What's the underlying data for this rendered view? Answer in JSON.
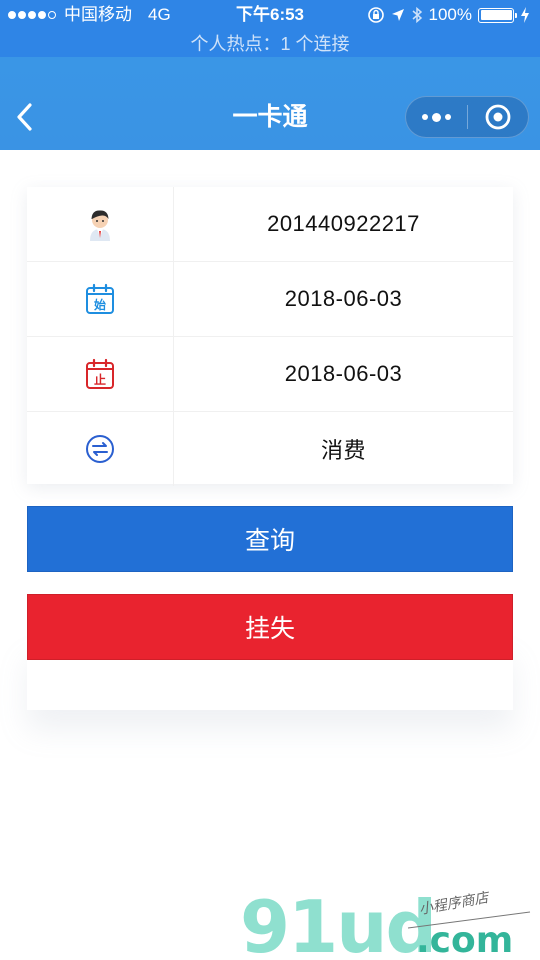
{
  "status_bar": {
    "carrier": "中国移动",
    "network": "4G",
    "time": "下午6:53",
    "battery": "100%",
    "battery_level": 1.0,
    "hotspot": "个人热点：1 个连接"
  },
  "nav": {
    "title": "一卡通",
    "back_icon": "chevron-left-icon",
    "more_icon": "more-dots-icon",
    "close_icon": "target-circle-icon"
  },
  "card": {
    "rows": [
      {
        "icon": "student-avatar-icon",
        "value": "201440922217"
      },
      {
        "icon": "calendar-start-icon",
        "icon_text": "始",
        "value": "2018-06-03"
      },
      {
        "icon": "calendar-end-icon",
        "icon_text": "止",
        "value": "2018-06-03"
      },
      {
        "icon": "exchange-icon",
        "value": "消费"
      }
    ]
  },
  "buttons": {
    "query": "查询",
    "report_lost": "挂失"
  },
  "watermark": {
    "brand": "91ud",
    "domain": ".com",
    "tagline": "小程序商店"
  },
  "colors": {
    "status_bar": "#2f85e6",
    "nav_bar": "#3a96e6",
    "query_button": "#2270d6",
    "lost_button": "#e9232f",
    "start_icon": "#1e8ee0",
    "end_icon": "#d8262a",
    "exchange_icon": "#2a5fd0",
    "watermark_brand": "#8fe0cf",
    "watermark_domain": "#33b59a"
  }
}
